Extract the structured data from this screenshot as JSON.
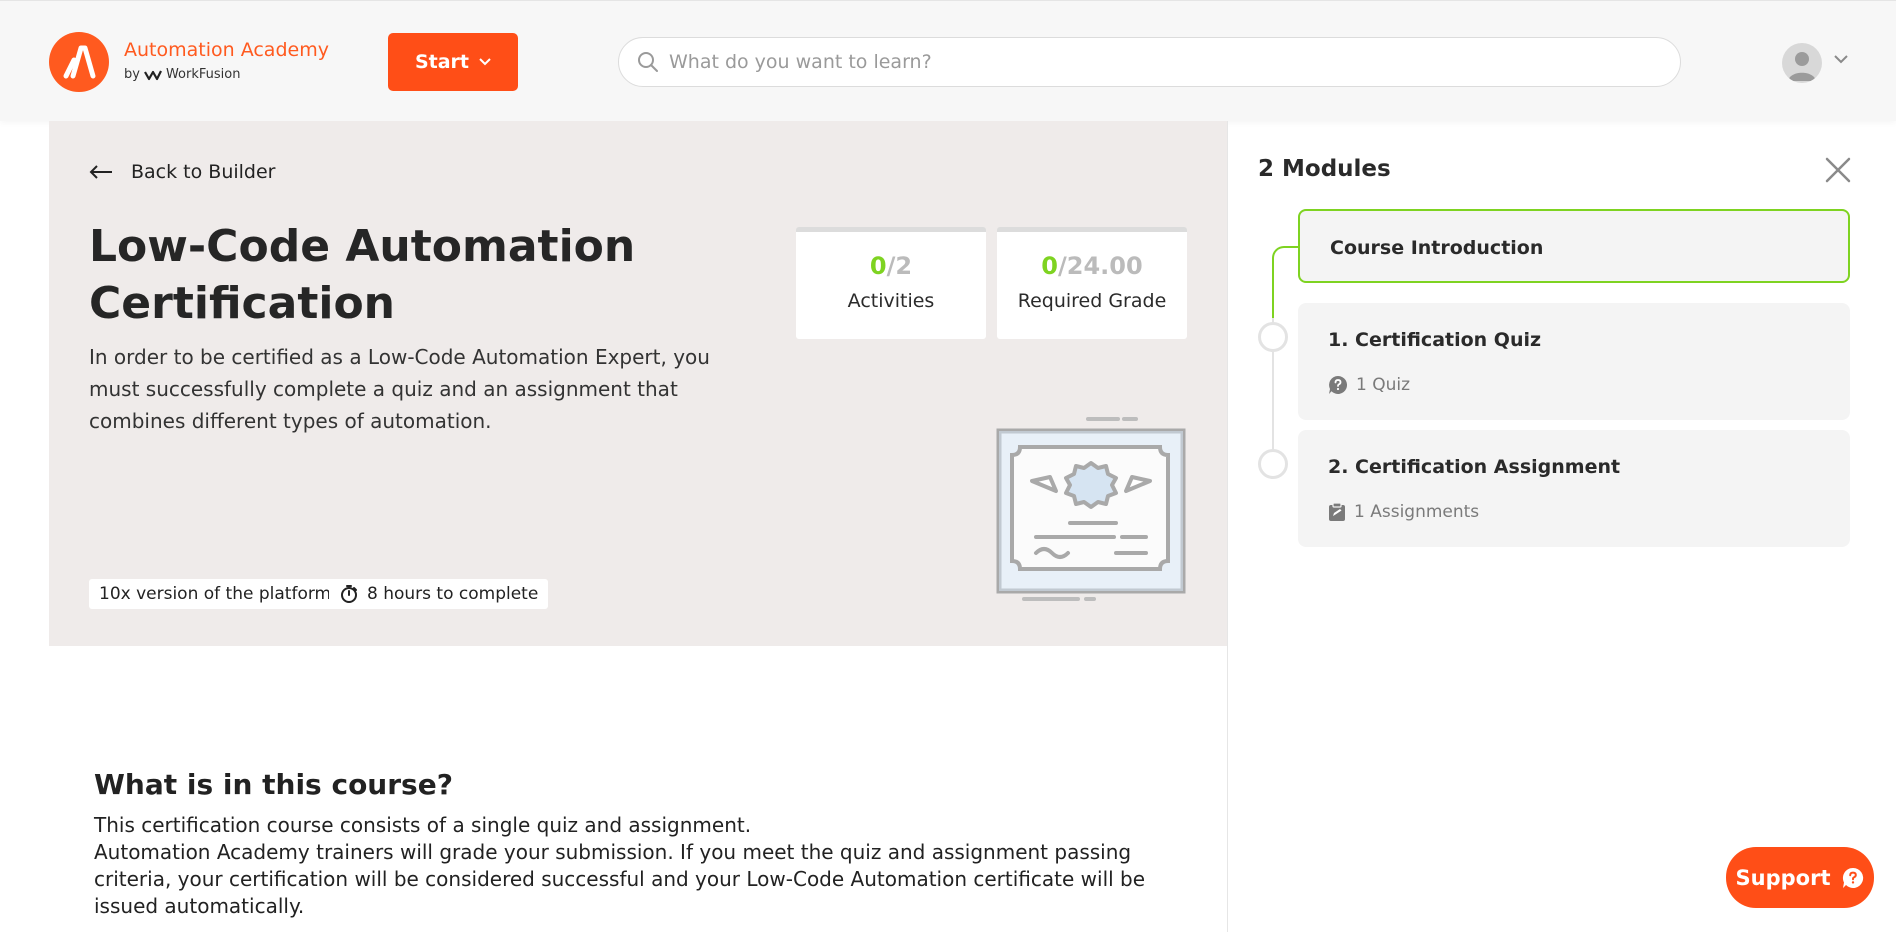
{
  "header": {
    "brand_name": "Automation Academy",
    "brand_by": "by",
    "brand_company": "WorkFusion",
    "start_label": "Start",
    "search_placeholder": "What do you want to learn?"
  },
  "hero": {
    "back_label": "Back to Builder",
    "title": "Low-Code Automation Certification",
    "description": "In order to be certified as a Low-Code Automation Expert, you must successfully complete a quiz and an assignment that combines different types of automation.",
    "stats": [
      {
        "current": "0",
        "total": "/2",
        "label": "Activities"
      },
      {
        "current": "0",
        "total": "/24.00",
        "label": "Required Grade"
      }
    ],
    "tags": [
      {
        "label": "10x version of the platform"
      },
      {
        "label": "8 hours to complete",
        "icon": "stopwatch-icon"
      }
    ]
  },
  "course_info": {
    "title": "What is in this course?",
    "paragraph_1": "This certification course consists of a single quiz and assignment.",
    "paragraph_2": "Automation Academy trainers will grade your submission. If you meet the quiz and assignment passing criteria, your certification will be considered successful and your Low-Code Automation certificate will be issued automatically."
  },
  "modules_panel": {
    "title": "2 Modules",
    "intro": {
      "title": "Course Introduction"
    },
    "modules": [
      {
        "title": "1. Certification Quiz",
        "meta": "1 Quiz",
        "icon": "quiz-icon"
      },
      {
        "title": "2. Certification Assignment",
        "meta": "1 Assignments",
        "icon": "assignment-icon"
      }
    ]
  },
  "support": {
    "label": "Support"
  },
  "colors": {
    "brand": "#ff5a1f",
    "button": "#ff4e17",
    "progress_green": "#7ed321",
    "hero_bg": "#efebea"
  }
}
